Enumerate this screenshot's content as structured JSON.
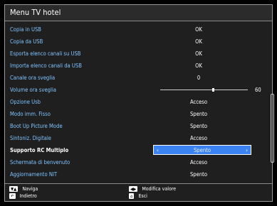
{
  "title": "Menu TV hotel",
  "items": [
    {
      "label": "Copia in USB",
      "value": "OK"
    },
    {
      "label": "Copia da USB",
      "value": "OK"
    },
    {
      "label": "Esporta elenco canali su USB",
      "value": "OK"
    },
    {
      "label": "Importa elenco canali da USB",
      "value": "OK"
    },
    {
      "label": "Canale ora sveglia",
      "value": "0"
    },
    {
      "label": "Volume ora sveglia",
      "value": "60",
      "type": "slider",
      "level": 0.6
    },
    {
      "label": "Opzione Usb",
      "value": "Acceso"
    },
    {
      "label": "Modo imm. Fisso",
      "value": "Spento"
    },
    {
      "label": "Boot Up Picture Mode",
      "value": "Spento"
    },
    {
      "label": "Sintoniz. Digitale",
      "value": "Acceso"
    },
    {
      "label": "Supporto RC Multiplo",
      "value": "Spento",
      "selected": true
    },
    {
      "label": "Schermata di benvenuto",
      "value": "Acceso"
    },
    {
      "label": "Aggiornamento NIT",
      "value": "Spento"
    }
  ],
  "footer": {
    "navigate": "Naviga",
    "back": "Indietro",
    "modify": "Modifica valore",
    "exit": "Esci"
  },
  "colors": {
    "label": "#7fc4ff",
    "selection": "#3b82f3",
    "panel": "#1f1f1f"
  }
}
